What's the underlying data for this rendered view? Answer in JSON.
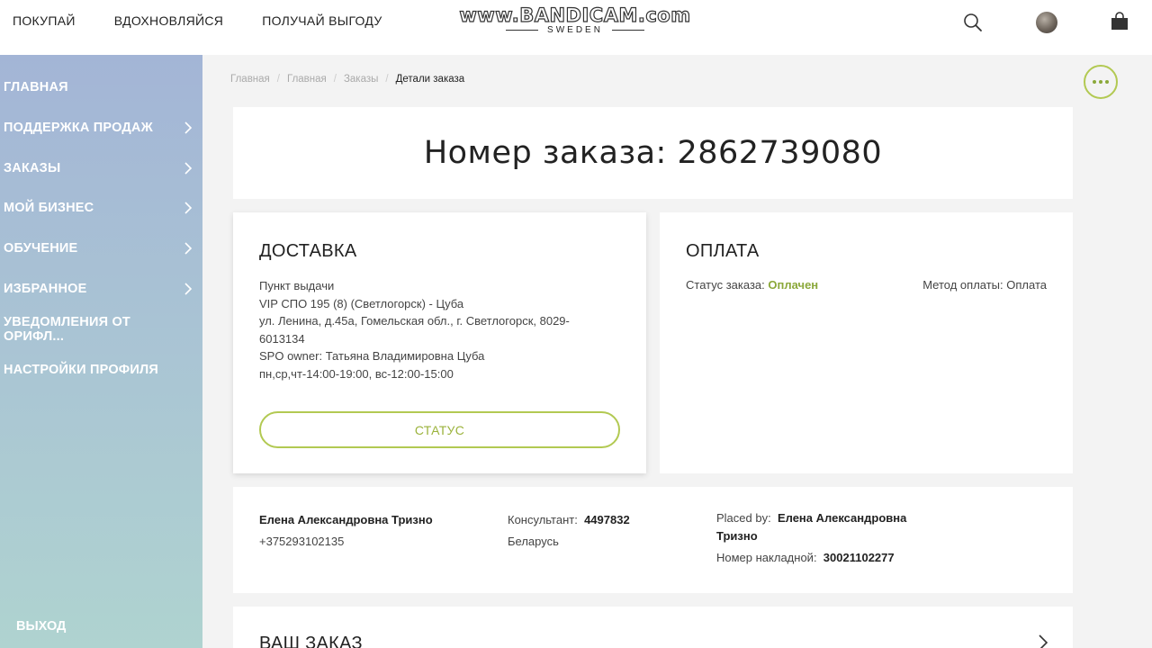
{
  "header": {
    "nav": [
      "ПОКУПАЙ",
      "ВДОХНОВЛЯЙСЯ",
      "ПОЛУЧАЙ ВЫГОДУ"
    ],
    "logo_watermark": "www.BANDICAM.com",
    "logo_sub": "SWEDEN"
  },
  "sidebar": {
    "items": [
      {
        "label": "ГЛАВНАЯ",
        "has_chevron": false
      },
      {
        "label": "ПОДДЕРЖКА ПРОДАЖ",
        "has_chevron": true
      },
      {
        "label": "ЗАКАЗЫ",
        "has_chevron": true
      },
      {
        "label": "МОЙ БИЗНЕС",
        "has_chevron": true
      },
      {
        "label": "ОБУЧЕНИЕ",
        "has_chevron": true
      },
      {
        "label": "ИЗБРАННОЕ",
        "has_chevron": true
      },
      {
        "label": "УВЕДОМЛЕНИЯ ОТ ОРИФЛ...",
        "has_chevron": false
      },
      {
        "label": "НАСТРОЙКИ ПРОФИЛЯ",
        "has_chevron": false
      }
    ],
    "exit_label": "ВЫХОД"
  },
  "breadcrumb": [
    "Главная",
    "Главная",
    "Заказы",
    "Детали заказа"
  ],
  "order": {
    "title": "Номер заказа: 2862739080"
  },
  "delivery": {
    "heading": "ДОСТАВКА",
    "lines": [
      "Пункт выдачи",
      "VIP СПО 195 (8) (Светлогорск) - Цуба",
      "ул. Ленина, д.45а, Гомельская обл., г. Светлогорск, 8029-6013134",
      "SPO owner: Татьяна Владимировна Цуба",
      "пн,ср,чт-14:00-19:00, вс-12:00-15:00"
    ],
    "status_button": "СТАТУС"
  },
  "payment": {
    "heading": "ОПЛАТА",
    "status_label": "Статус заказа:",
    "status_value": "Оплачен",
    "method_label": "Метод оплаты:",
    "method_value": "Оплата"
  },
  "customer": {
    "name": "Елена Александровна Тризно",
    "phone": "+375293102135",
    "consultant_label": "Консультант:",
    "consultant_id": "4497832",
    "country": "Беларусь",
    "placed_by_label": "Placed by:",
    "placed_by_value": "Елена Александровна Тризно",
    "invoice_label": "Номер накладной:",
    "invoice_value": "30021102277"
  },
  "your_order": {
    "heading": "ВАШ ЗАКАЗ"
  },
  "colors": {
    "accent_green": "#b2c952",
    "paid_green": "#8ba83a",
    "sidebar_top": "#a3b5d6",
    "sidebar_bottom": "#afd3d0"
  }
}
